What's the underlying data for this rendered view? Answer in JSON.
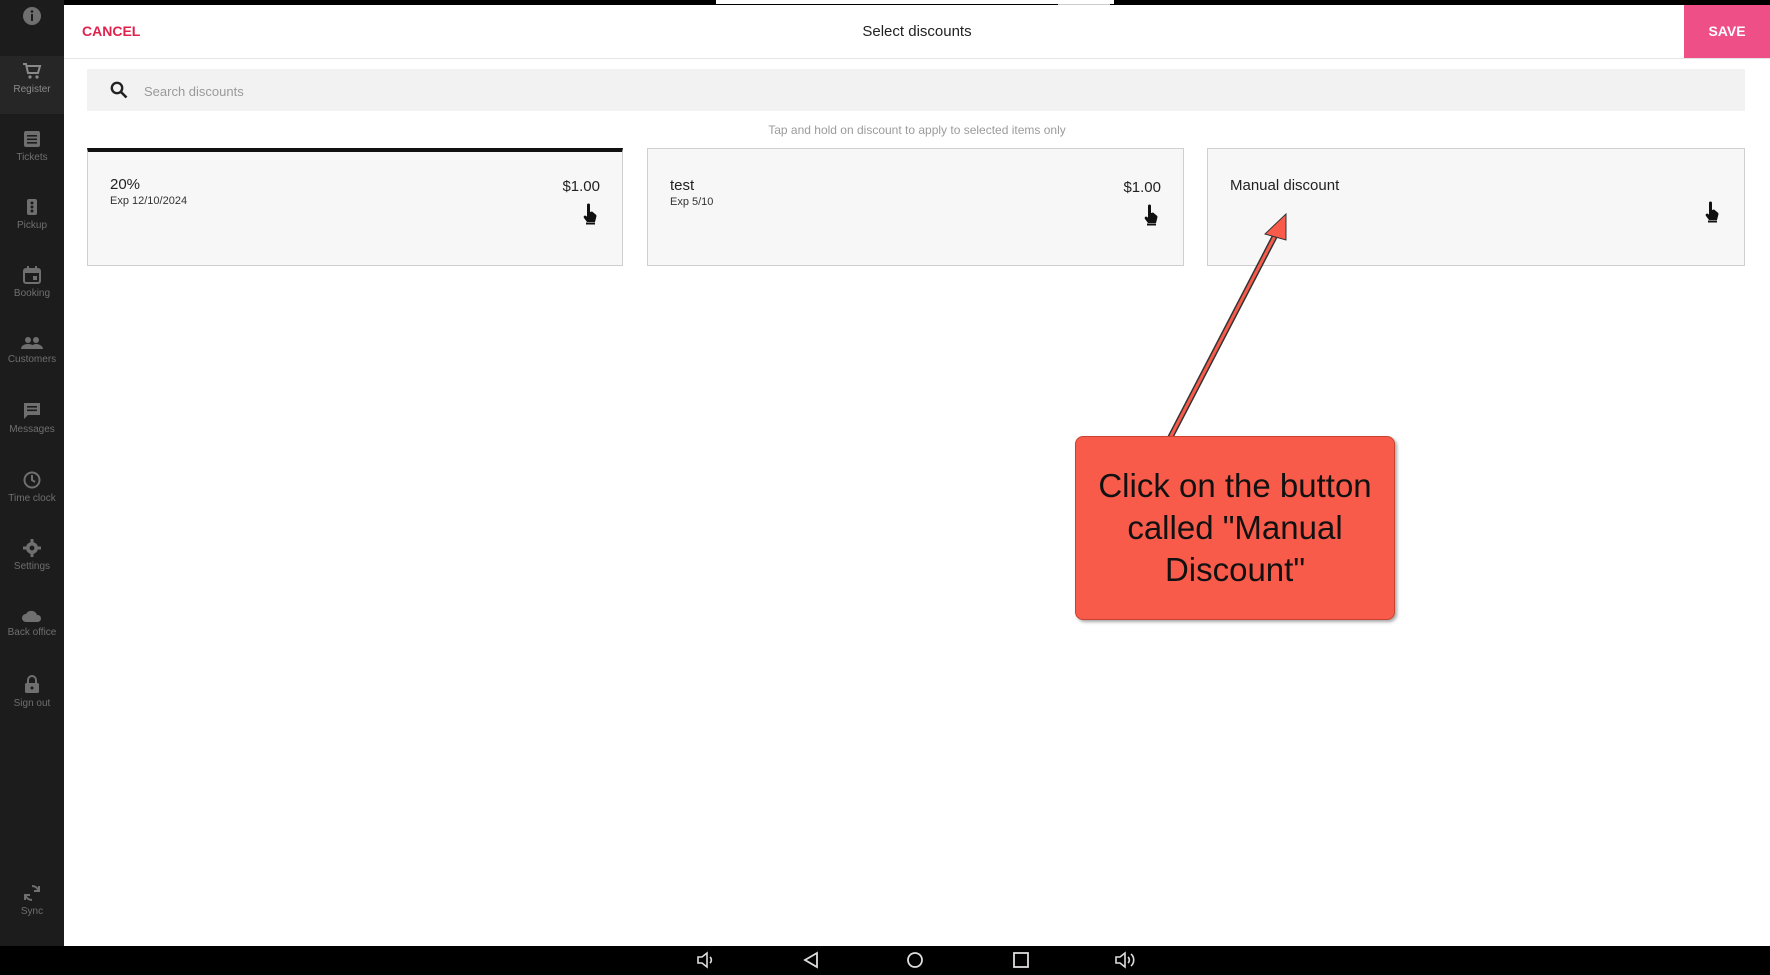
{
  "sidebar": {
    "items": [
      {
        "label": "",
        "icon": "info-icon"
      },
      {
        "label": "Register",
        "icon": "cart-icon"
      },
      {
        "label": "Tickets",
        "icon": "tickets-icon"
      },
      {
        "label": "Pickup",
        "icon": "pickup-icon"
      },
      {
        "label": "Booking",
        "icon": "calendar-icon"
      },
      {
        "label": "Customers",
        "icon": "people-icon"
      },
      {
        "label": "Messages",
        "icon": "message-icon"
      },
      {
        "label": "Time clock",
        "icon": "clock-icon"
      },
      {
        "label": "Settings",
        "icon": "gear-icon"
      },
      {
        "label": "Back office",
        "icon": "cloud-icon"
      },
      {
        "label": "Sign out",
        "icon": "lock-icon"
      },
      {
        "label": "Sync",
        "icon": "sync-icon"
      }
    ]
  },
  "header": {
    "cancel_label": "CANCEL",
    "title": "Select discounts",
    "save_label": "SAVE"
  },
  "search": {
    "placeholder": "Search discounts"
  },
  "hint": "Tap and hold on discount to apply to selected items only",
  "discounts": [
    {
      "name": "20%",
      "expiry": "Exp 12/10/2024",
      "amount": "$1.00",
      "selected": true
    },
    {
      "name": "test",
      "expiry": "Exp 5/10",
      "amount": "$1.00",
      "selected": false
    },
    {
      "name": "Manual discount",
      "expiry": "",
      "amount": "",
      "selected": false
    }
  ],
  "callout": {
    "text": "Click on the button called \"Manual Discount\""
  },
  "colors": {
    "accent": "#e0234d",
    "save_bg": "#ee4f86",
    "callout_bg": "#f95b4b",
    "sidebar_bg": "#1c1c1c"
  }
}
